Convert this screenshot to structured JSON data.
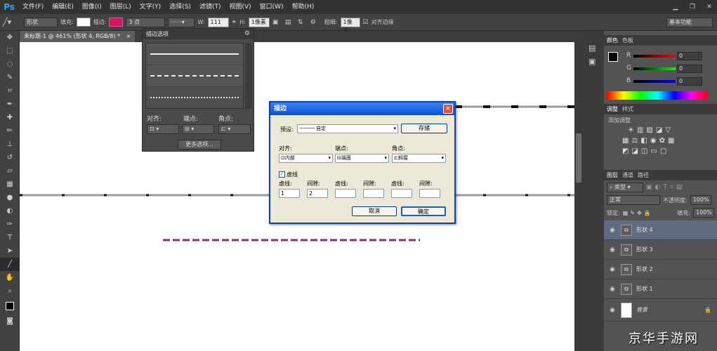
{
  "app": {
    "logo": "Ps"
  },
  "menu": [
    "文件(F)",
    "编辑(E)",
    "图像(I)",
    "图层(L)",
    "文字(Y)",
    "选择(S)",
    "滤镜(T)",
    "视图(V)",
    "窗口(W)",
    "帮助(H)"
  ],
  "options": {
    "mode": "形状",
    "fill_label": "填充:",
    "stroke_label": "描边:",
    "stroke_width": "3 点",
    "w_label": "W:",
    "w_value": "111 像",
    "h_label": "H:",
    "h_value": "1像素",
    "thickness_label": "粗细:",
    "thickness_value": "1像素",
    "align_edges": "对齐边缘",
    "workspace": "基本功能",
    "stroke_color": "#e0115f"
  },
  "document": {
    "tab": "未标题-1 @ 461% (形状 4, RGB/8) *",
    "tab_close": "×"
  },
  "stroke_popup": {
    "title": "描边选项",
    "align_label": "对齐:",
    "caps_label": "端点:",
    "corners_label": "角点:",
    "more": "更多选项..."
  },
  "dialog": {
    "title": "描边",
    "close": "×",
    "preset_label": "预设:",
    "preset_value": "自定",
    "save": "存储",
    "align_label": "对齐:",
    "align_value": "内部",
    "caps_label": "端点:",
    "caps_value": "端面",
    "corners_label": "角点:",
    "corners_value": "斜接",
    "dashed_label": "虚线",
    "dash_labels": [
      "虚线:",
      "间隙:",
      "虚线:",
      "间隙:",
      "虚线:",
      "间隙:"
    ],
    "dash_values": [
      "1",
      "2",
      "",
      "",
      "",
      ""
    ],
    "cancel": "取消",
    "ok": "确定"
  },
  "color_panel": {
    "tabs": [
      "颜色",
      "色板"
    ],
    "channels": [
      {
        "name": "R",
        "value": "0"
      },
      {
        "name": "G",
        "value": "0"
      },
      {
        "name": "B",
        "value": "0"
      }
    ]
  },
  "adjust_panel": {
    "tabs": [
      "调整",
      "样式"
    ],
    "add_label": "添加调整"
  },
  "layers_panel": {
    "tabs": [
      "图层",
      "通道",
      "路径"
    ],
    "filter_label": "类型",
    "blend_mode": "正常",
    "opacity_label": "不透明度:",
    "opacity_value": "100%",
    "lock_label": "锁定:",
    "fill_label": "填充:",
    "fill_value": "100%",
    "layers": [
      "形状 4",
      "形状 3",
      "形状 2",
      "形状 1",
      "背景"
    ]
  },
  "watermark": "京华手游网"
}
